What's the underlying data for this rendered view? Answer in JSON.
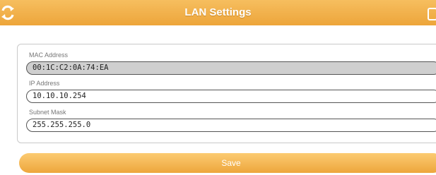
{
  "header": {
    "title": "LAN Settings",
    "back_icon": "refresh-back-icon",
    "menu_icon": "menu-icon"
  },
  "form": {
    "mac": {
      "label": "MAC Address",
      "value": "00:1C:C2:0A:74:EA"
    },
    "ip": {
      "label": "IP Address",
      "value": "10.10.10.254"
    },
    "mask": {
      "label": "Subnet Mask",
      "value": "255.255.255.0"
    }
  },
  "actions": {
    "save_label": "Save"
  },
  "colors": {
    "accent": "#f0ab45",
    "readonly_bg": "#cfcfcf"
  }
}
